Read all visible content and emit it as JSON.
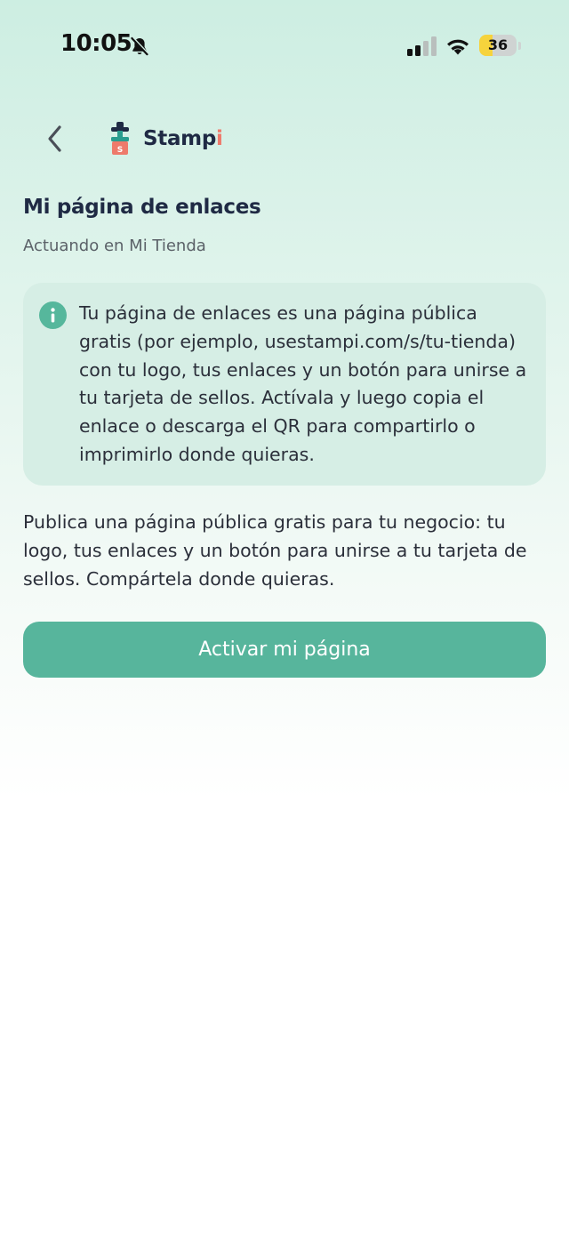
{
  "status_bar": {
    "time": "10:05",
    "battery_level": "36",
    "battery_fraction": 0.36,
    "icons": [
      "bell-slash-icon",
      "cellular-signal-icon",
      "wifi-icon",
      "battery-charging-icon"
    ]
  },
  "header": {
    "back_icon": "chevron-left-icon",
    "brand_main": "Stamp",
    "brand_accent": "i"
  },
  "page": {
    "title": "Mi página de enlaces",
    "subtitle": "Actuando en Mi Tienda"
  },
  "info_card": {
    "icon": "info-icon",
    "text": "Tu página de enlaces es una página pública gratis (por ejemplo, usestampi.com/s/tu-tienda) con tu logo, tus enlaces y un botón para unirse a tu tarjeta de sellos. Actívala y luego copia el enlace o descarga el QR para compartirlo o imprimirlo donde quieras."
  },
  "description": "Publica una página pública gratis para tu negocio: tu logo, tus enlaces y un botón para unirse a tu tarjeta de sellos. Compártela donde quieras.",
  "actions": {
    "activate_label": "Activar mi página"
  },
  "colors": {
    "accent": "#57b59c",
    "card_background": "#d6eee5",
    "title": "#1f2a44",
    "brand_accent": "#ee7a6b",
    "battery_fill": "#f6d33c"
  }
}
